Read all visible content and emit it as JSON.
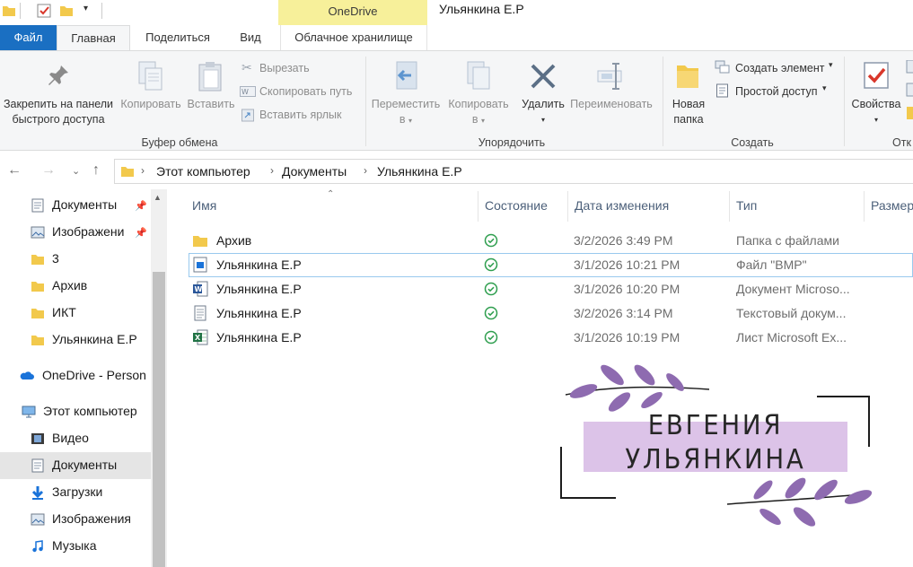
{
  "titlebar": {
    "context_tab": "OneDrive",
    "window_title": "Ульянкина Е.Р"
  },
  "tabs": {
    "file": "Файл",
    "home": "Главная",
    "share": "Поделиться",
    "view": "Вид",
    "cloud": "Облачное хранилище"
  },
  "ribbon": {
    "clipboard": {
      "pin_label_1": "Закрепить на панели",
      "pin_label_2": "быстрого доступа",
      "copy": "Копировать",
      "paste": "Вставить",
      "cut": "Вырезать",
      "copy_path": "Скопировать путь",
      "paste_shortcut": "Вставить ярлык",
      "group": "Буфер обмена"
    },
    "organize": {
      "move_1": "Переместить",
      "move_2": "в",
      "copy_1": "Копировать",
      "copy_2": "в",
      "delete": "Удалить",
      "rename": "Переименовать",
      "group": "Упорядочить"
    },
    "new": {
      "folder_1": "Новая",
      "folder_2": "папка",
      "new_item": "Создать элемент",
      "easy_access": "Простой доступ",
      "group": "Создать"
    },
    "open": {
      "properties": "Свойства",
      "group": "Отк"
    }
  },
  "address": {
    "crumbs": [
      "Этот компьютер",
      "Документы",
      "Ульянкина Е.Р"
    ]
  },
  "navpane": {
    "items": [
      {
        "label": "Документы",
        "icon": "documents-icon",
        "pinned": true
      },
      {
        "label": "Изображени",
        "icon": "pictures-icon",
        "pinned": true
      },
      {
        "label": "3",
        "icon": "folder-icon"
      },
      {
        "label": "Архив",
        "icon": "folder-icon"
      },
      {
        "label": "ИКТ",
        "icon": "folder-icon"
      },
      {
        "label": "Ульянкина Е.Р",
        "icon": "folder-icon"
      },
      {
        "label": "OneDrive - Person",
        "icon": "onedrive-cloud-icon"
      },
      {
        "label": "Этот компьютер",
        "icon": "computer-icon"
      },
      {
        "label": "Видео",
        "icon": "video-icon"
      },
      {
        "label": "Документы",
        "icon": "documents-icon",
        "selected": true
      },
      {
        "label": "Загрузки",
        "icon": "downloads-icon"
      },
      {
        "label": "Изображения",
        "icon": "pictures-icon"
      },
      {
        "label": "Музыка",
        "icon": "music-icon"
      }
    ]
  },
  "filelist": {
    "columns": [
      "Имя",
      "Состояние",
      "Дата изменения",
      "Тип",
      "Размер"
    ],
    "rows": [
      {
        "name": "Архив",
        "date": "3/2/2026 3:49 PM",
        "type": "Папка с файлами",
        "icon": "folder-icon"
      },
      {
        "name": "Ульянкина Е.Р",
        "date": "3/1/2026 10:21 PM",
        "type": "Файл \"BMP\"",
        "icon": "bmp-file-icon",
        "focused": true
      },
      {
        "name": "Ульянкина Е.Р",
        "date": "3/1/2026 10:20 PM",
        "type": "Документ Microso...",
        "icon": "word-file-icon"
      },
      {
        "name": "Ульянкина Е.Р",
        "date": "3/2/2026 3:14 PM",
        "type": "Текстовый докум...",
        "icon": "text-file-icon"
      },
      {
        "name": "Ульянкина Е.Р",
        "date": "3/1/2026 10:19 PM",
        "type": "Лист Microsoft Ex...",
        "icon": "excel-file-icon"
      }
    ]
  },
  "badge": {
    "line1": "ЕВГЕНИЯ",
    "line2": "УЛЬЯНКИНА"
  },
  "colors": {
    "accent": "#1a6fc2",
    "context_tab": "#f7f09a",
    "status_ok": "#2e9e4e",
    "badge_fill": "#dcc3e8",
    "leaf": "#8e6bb0"
  }
}
